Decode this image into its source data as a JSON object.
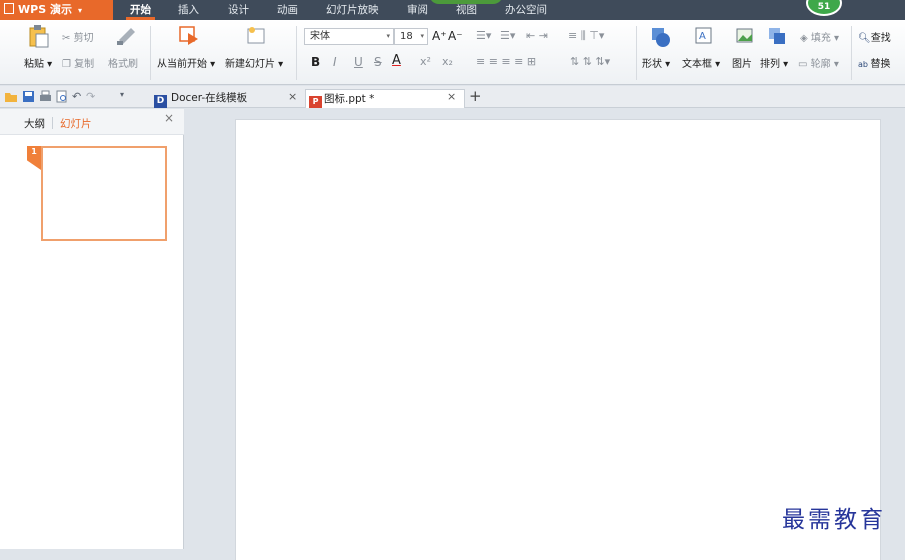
{
  "app": {
    "name": "WPS 演示",
    "menu_caret": "▾"
  },
  "menu_tabs": [
    "开始",
    "插入",
    "设计",
    "动画",
    "幻灯片放映",
    "审阅",
    "视图",
    "办公空间"
  ],
  "notification_badge": "51",
  "ribbon": {
    "clipboard": {
      "paste": "粘贴",
      "cut": "剪切",
      "copy": "复制",
      "format_painter": "格式刷"
    },
    "slides": {
      "from_current": "从当前开始",
      "new_slide": "新建幻灯片"
    },
    "font": {
      "family": "宋体",
      "size": "18",
      "bold": "B",
      "italic": "I",
      "underline": "U",
      "strike": "S",
      "color": "A",
      "superscript": "x²",
      "subscript": "x₂",
      "grow": "A⁺",
      "shrink": "A⁻"
    },
    "insert": {
      "shape": "形状",
      "textbox": "文本框",
      "picture": "图片",
      "arrange": "排列",
      "outline": "轮廓",
      "fill": "填充"
    },
    "edit": {
      "find": "查找",
      "replace": "替换"
    }
  },
  "doc_tabs": [
    {
      "label": "Docer-在线模板",
      "icon": "docer-icon"
    },
    {
      "label": "图标.ppt *",
      "icon": "ppt-icon"
    }
  ],
  "new_tab_symbol": "+",
  "close_symbol": "×",
  "left_pane": {
    "tabs": [
      "大纲",
      "幻灯片"
    ],
    "active_tab": "幻灯片",
    "slide_numbers": [
      "1"
    ]
  },
  "watermark": "最需教育",
  "colors": {
    "accent": "#e8692a",
    "menubar": "#3f4b5a",
    "thumb_border": "#f0a06c",
    "watermark": "#26359a"
  }
}
